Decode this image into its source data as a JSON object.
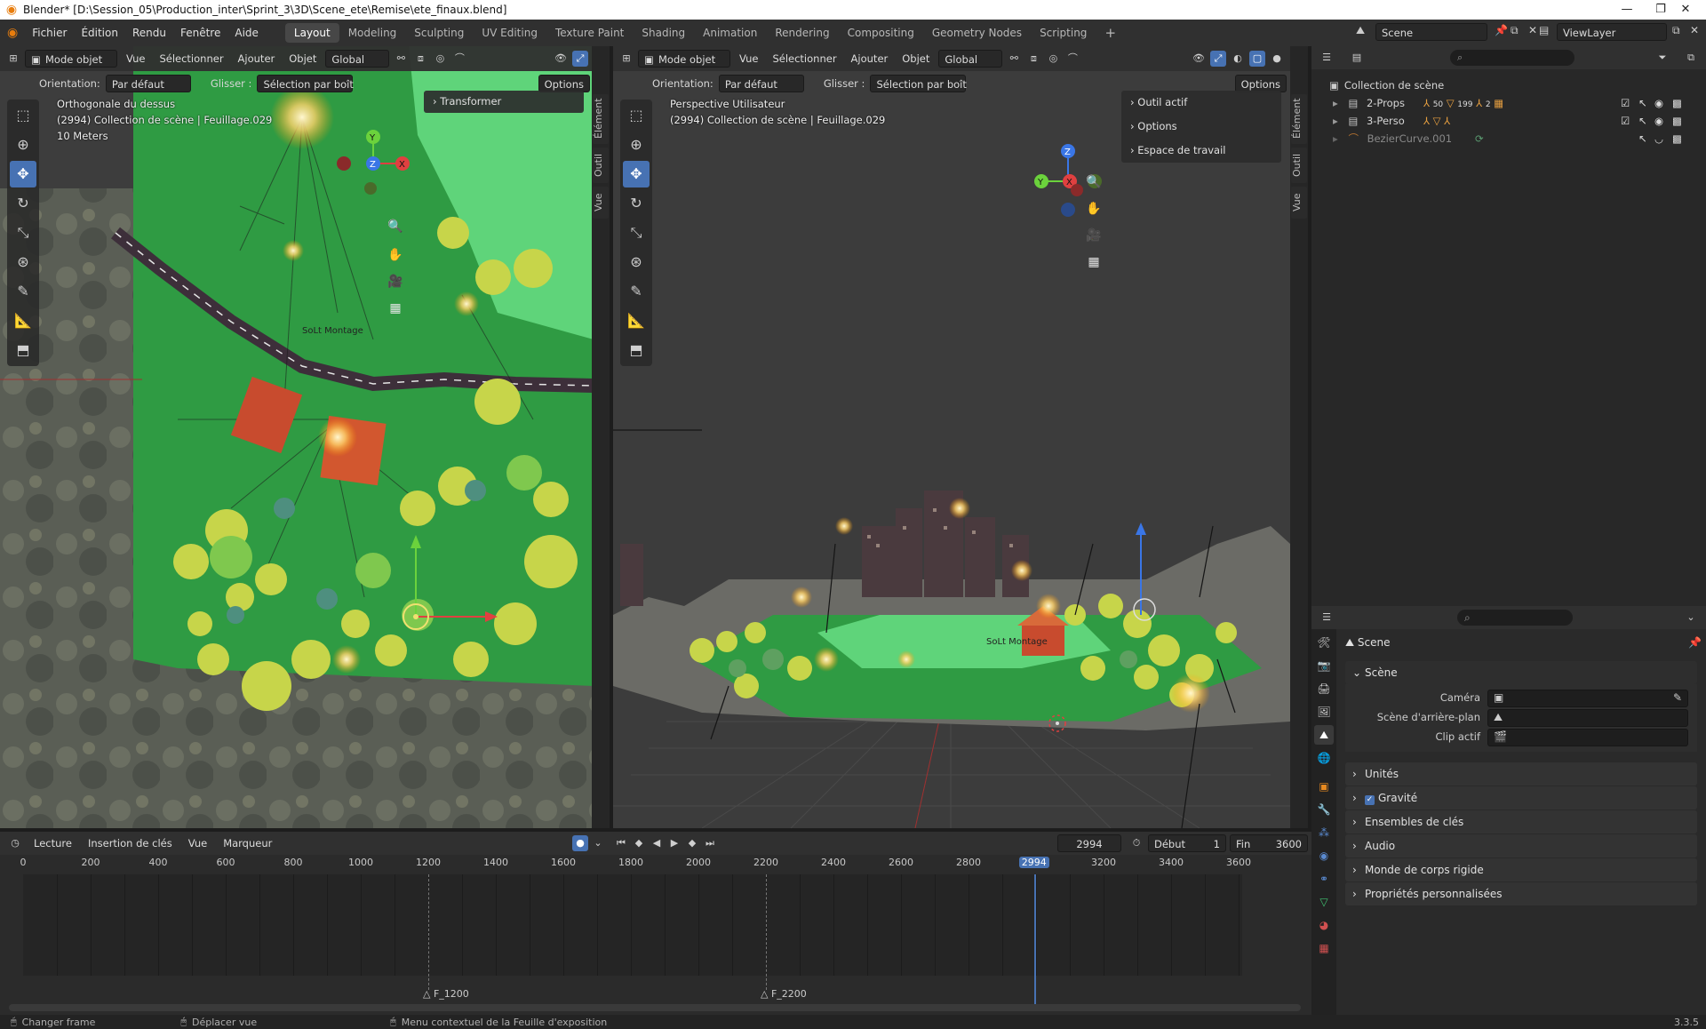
{
  "window": {
    "title": "Blender* [D:\\Session_05\\Production_inter\\Sprint_3\\3D\\Scene_ete\\Remise\\ete_finaux.blend]",
    "minimize": "—",
    "maximize": "❐",
    "close": "✕"
  },
  "menu": {
    "items": [
      "Fichier",
      "Édition",
      "Rendu",
      "Fenêtre",
      "Aide"
    ]
  },
  "workspaces": [
    "Layout",
    "Modeling",
    "Sculpting",
    "UV Editing",
    "Texture Paint",
    "Shading",
    "Animation",
    "Rendering",
    "Compositing",
    "Geometry Nodes",
    "Scripting"
  ],
  "workspaces_add": "+",
  "active_workspace": "Layout",
  "scene_selector": "Scene",
  "viewlayer_selector": "ViewLayer",
  "viewport_left": {
    "mode": "Mode objet",
    "menus": [
      "Vue",
      "Sélectionner",
      "Ajouter",
      "Objet"
    ],
    "transform_orientation": "Global",
    "orientation_label": "Orientation:",
    "orientation_value": "Par défaut",
    "drag_label": "Glisser :",
    "drag_value": "Sélection par boît",
    "options": "Options",
    "info_view": "Orthogonale du dessus",
    "info_object": "(2994) Collection de scène | Feuillage.029",
    "info_scale": "10 Meters",
    "npanel_header": "Transformer",
    "side_tabs": [
      "Élément",
      "Outil",
      "Vue"
    ],
    "overlay_label": "SoLt Montage"
  },
  "viewport_right": {
    "mode": "Mode objet",
    "menus": [
      "Vue",
      "Sélectionner",
      "Ajouter",
      "Objet"
    ],
    "transform_orientation": "Global",
    "orientation_label": "Orientation:",
    "orientation_value": "Par défaut",
    "drag_label": "Glisser :",
    "drag_value": "Sélection par boît",
    "options": "Options",
    "info_view": "Perspective Utilisateur",
    "info_object": "(2994) Collection de scène | Feuillage.029",
    "npanel_rows": [
      "Outil actif",
      "Options",
      "Espace de travail"
    ],
    "side_tabs": [
      "Élément",
      "Outil",
      "Vue"
    ],
    "overlay_label": "SoLt Montage"
  },
  "outliner": {
    "root": "Collection de scène",
    "rows": [
      {
        "name": "2-Props",
        "badges": [
          "50",
          "199",
          "2"
        ]
      },
      {
        "name": "3-Perso",
        "badges": []
      },
      {
        "name": "BezierCurve.001",
        "badges": []
      }
    ]
  },
  "properties": {
    "context": "Scene",
    "panel_title": "Scène",
    "fields": [
      {
        "label": "Caméra",
        "value": ""
      },
      {
        "label": "Scène d'arrière-plan",
        "value": ""
      },
      {
        "label": "Clip actif",
        "value": ""
      }
    ],
    "collapsed_panels": [
      "Unités",
      "Gravité",
      "Ensembles de clés",
      "Audio",
      "Monde de corps rigide",
      "Propriétés personnalisées"
    ],
    "gravity_checked": true
  },
  "timeline": {
    "menus": [
      "Lecture",
      "Insertion de clés",
      "Vue",
      "Marqueur"
    ],
    "current_frame": "2994",
    "start_label": "Début",
    "start_value": "1",
    "end_label": "Fin",
    "end_value": "3600",
    "ruler": [
      "0",
      "200",
      "400",
      "600",
      "800",
      "1000",
      "1200",
      "1400",
      "1600",
      "1800",
      "2000",
      "2200",
      "2400",
      "2600",
      "2800",
      "2994",
      "3200",
      "3400",
      "3600"
    ],
    "markers": [
      {
        "label": "F_1200",
        "frame": 1200
      },
      {
        "label": "F_2200",
        "frame": 2200
      }
    ],
    "playhead_frame": 2994
  },
  "status": {
    "items": [
      "Changer frame",
      "Déplacer vue",
      "Menu contextuel de la Feuille d'exposition"
    ],
    "version": "3.3.5"
  },
  "colors": {
    "accent_blue": "#4772b3",
    "grass": "#2f9b43",
    "light_grass": "#5fd47a",
    "road": "#3d2f3a",
    "house": "#c84b2e",
    "tree_yellow": "#c7d54a",
    "blender_orange": "#e87d0d"
  },
  "icons": {
    "blender": "blender-logo-icon",
    "search": "search-icon",
    "filter": "filter-icon",
    "eye": "eye-icon",
    "camera": "camera-icon",
    "hand": "hand-pan-icon",
    "zoom": "zoom-icon",
    "grid": "grid-icon",
    "cursor": "cursor-icon",
    "move": "move-icon",
    "rotate": "rotate-icon",
    "scale": "scale-icon",
    "transform": "transform-icon",
    "annotate": "annotate-icon",
    "measure": "measure-icon",
    "add_cube": "add-cube-icon"
  }
}
